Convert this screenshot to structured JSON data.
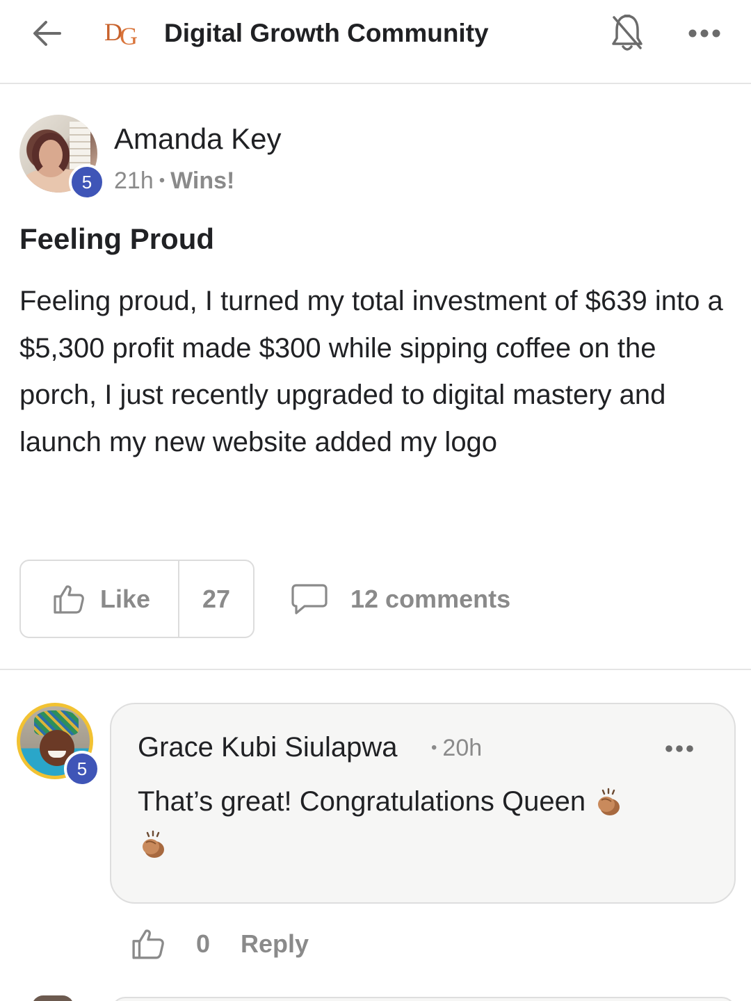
{
  "header": {
    "logo_text": "DG",
    "title": "Digital Growth Community"
  },
  "post": {
    "author": "Amanda Key",
    "level": "5",
    "time": "21h",
    "separator": "•",
    "category": "Wins!",
    "title": "Feeling Proud",
    "body": "Feeling proud, I turned my total investment of $639 into a $5,300 profit made $300 while sipping coffee on the porch, I just recently upgraded to digital mastery and launch my new website added my logo",
    "like_label": "Like",
    "like_count": "27",
    "comments_label": "12 comments"
  },
  "comment": {
    "author": "Grace Kubi Siulapwa",
    "level": "5",
    "separator": "•",
    "time": "20h",
    "text": "That’s great! Congratulations Queen",
    "like_count": "0",
    "reply_label": "Reply"
  },
  "colors": {
    "badge": "#3f55b7",
    "muted": "#8a8a8a",
    "text": "#202124",
    "logo": "#c8622c",
    "bubble": "#f6f6f5",
    "avatar_ring": "#f2c232"
  },
  "icons": {
    "back": "arrow-left-icon",
    "bell": "bell-off-icon",
    "more": "more-horizontal-icon",
    "like": "thumbs-up-icon",
    "comment": "speech-bubble-icon",
    "clap": "clapping-hands-emoji"
  }
}
